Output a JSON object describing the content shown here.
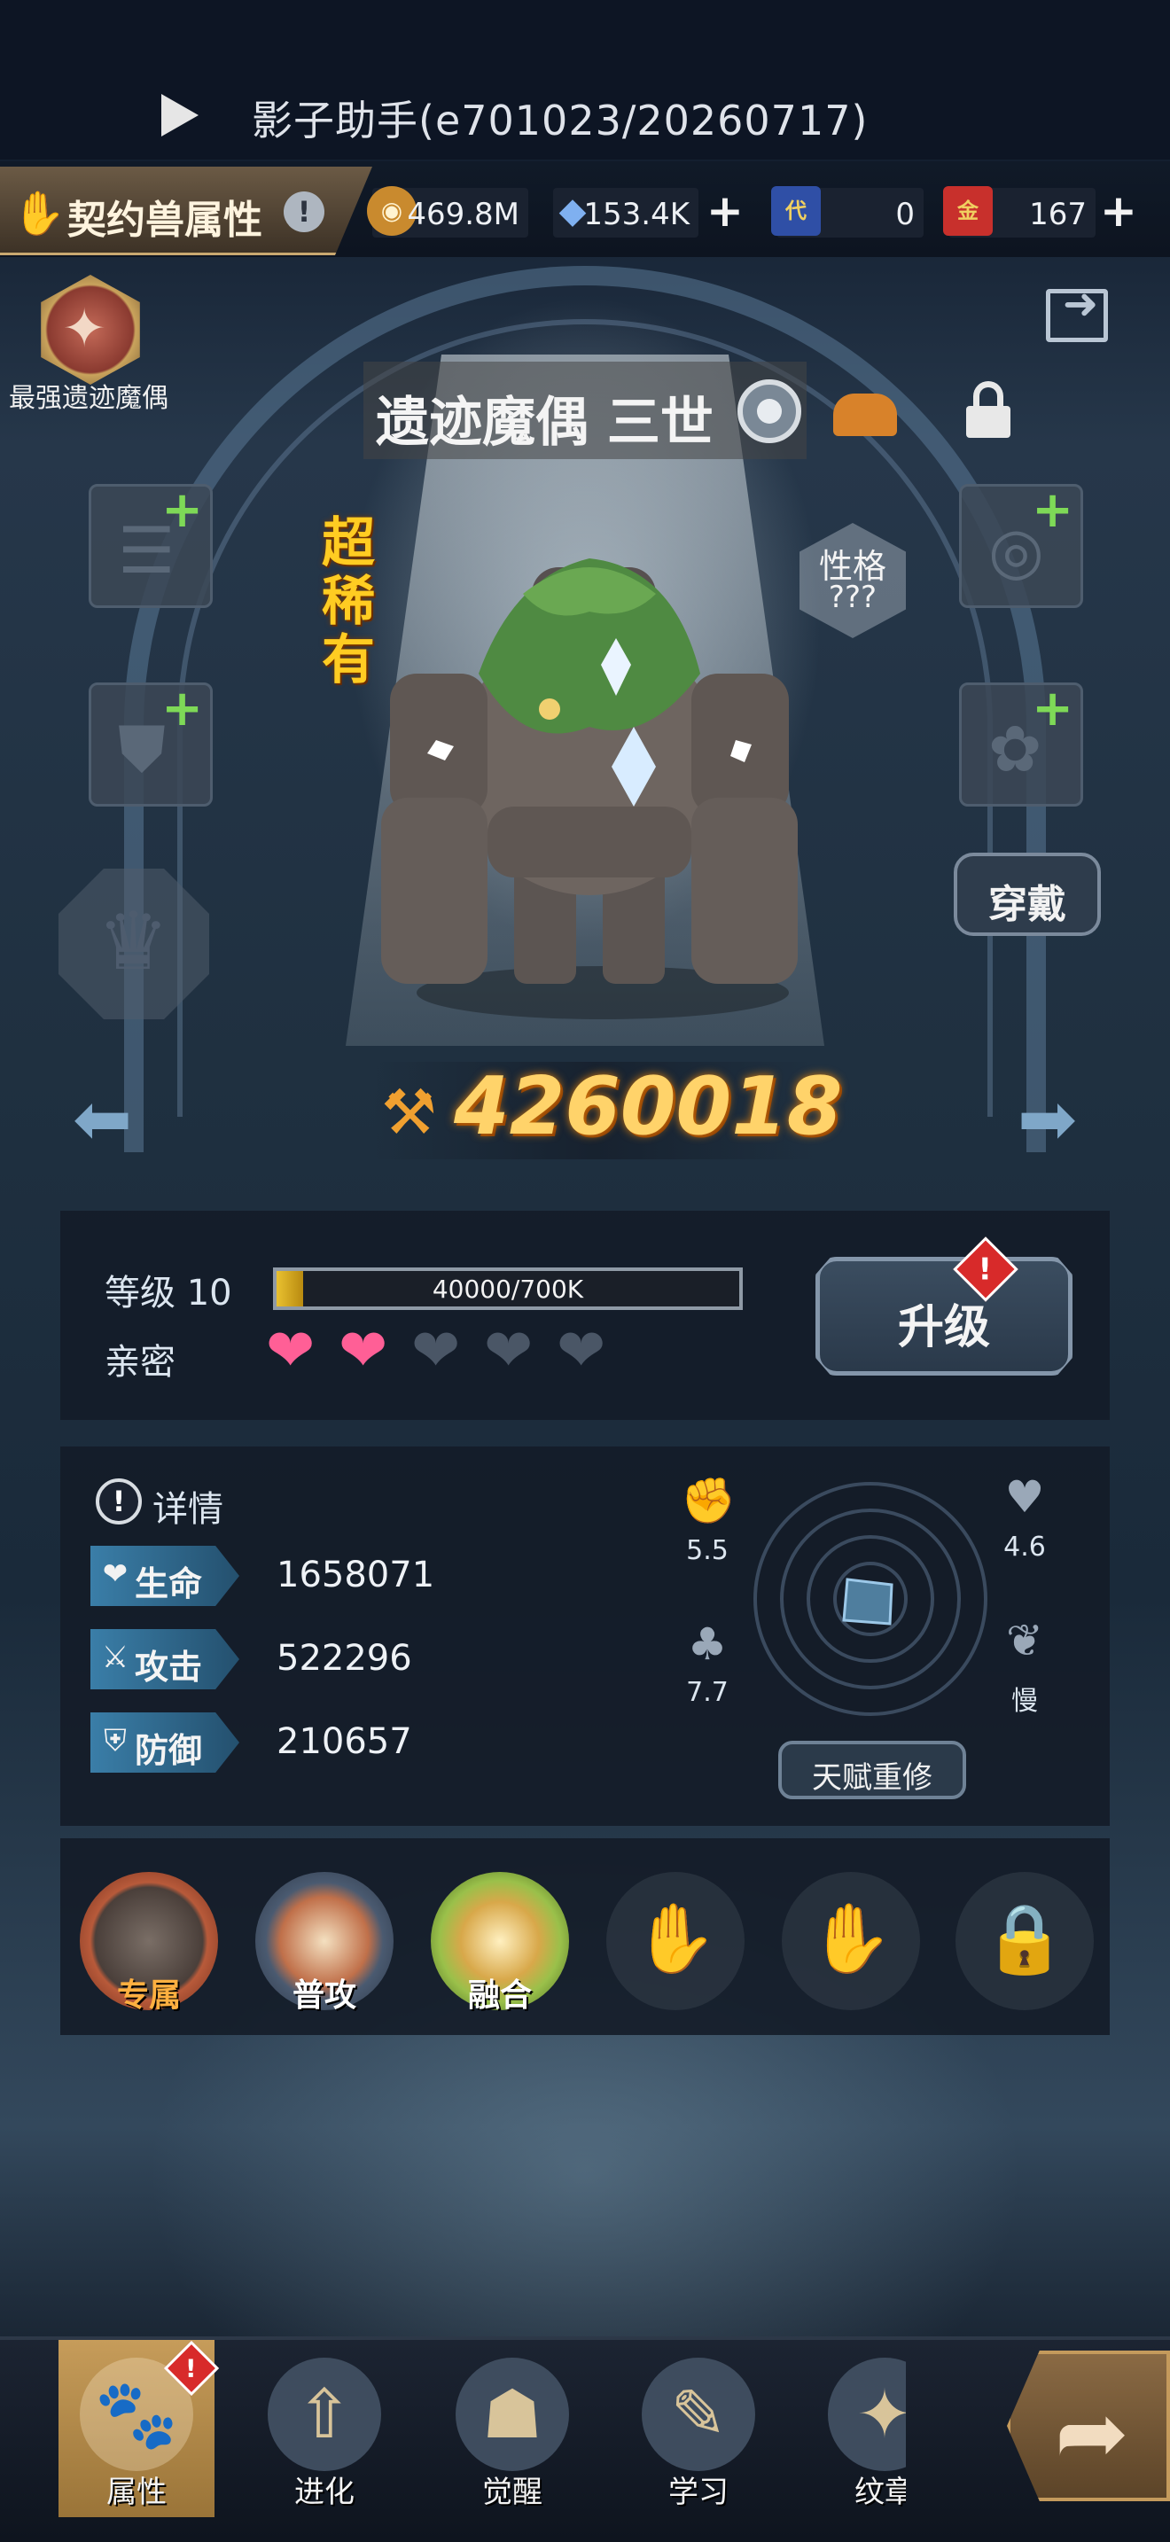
{
  "window": {
    "title": "影子助手(e701023/20260717)"
  },
  "header": {
    "page_title": "契约兽属性",
    "info_badge": "!",
    "currencies": [
      {
        "name": "gold-coin",
        "value": "469.8M",
        "color": "#c98a2e"
      },
      {
        "name": "crystal",
        "value": "153.4K",
        "color": "#5b8fd8"
      },
      {
        "name": "substitute-ticket",
        "icon_text": "代",
        "value": "0",
        "color": "#2f4fa6"
      },
      {
        "name": "gold-ticket",
        "icon_text": "金",
        "value": "167",
        "color": "#c8302c"
      }
    ]
  },
  "champion": {
    "label": "最强遗迹魔偶"
  },
  "monster": {
    "name": "遗迹魔偶 三世",
    "rarity": "超稀有",
    "personality_label": "性格",
    "personality_value": "???",
    "combat_power": "4260018"
  },
  "equip": {
    "button_label": "穿戴"
  },
  "level": {
    "label": "等级 10",
    "exp_text": "40000/700K",
    "exp_fraction": 0.057,
    "intimacy_label": "亲密",
    "intimacy_hearts": 2,
    "intimacy_max": 5,
    "upgrade_label": "升级",
    "alert": "!"
  },
  "stats": {
    "details_label": "详情",
    "rows": [
      {
        "icon": "heart-icon",
        "glyph": "❤",
        "name": "生命",
        "value": "1658071"
      },
      {
        "icon": "sword-icon",
        "glyph": "⚔",
        "name": "攻击",
        "value": "522296"
      },
      {
        "icon": "shield-icon",
        "glyph": "⛨",
        "name": "防御",
        "value": "210657"
      }
    ],
    "talents": [
      {
        "icon": "fist-icon",
        "glyph": "✊",
        "value": "5.5"
      },
      {
        "icon": "heart-outline-icon",
        "glyph": "♥",
        "value": "4.6"
      },
      {
        "icon": "clover-icon",
        "glyph": "♣",
        "value": "7.7"
      },
      {
        "icon": "wing-icon",
        "glyph": "❦",
        "value": "慢"
      }
    ],
    "reset_label": "天赋重修"
  },
  "skills": [
    {
      "label": "专属",
      "color": "#b85a3a"
    },
    {
      "label": "普攻",
      "color": "#6e8aa8"
    },
    {
      "label": "融合",
      "color": "#9ac04a"
    }
  ],
  "nav": {
    "items": [
      {
        "label": "属性",
        "glyph": "🐾",
        "active": true,
        "badge": "!"
      },
      {
        "label": "进化",
        "glyph": "⇧"
      },
      {
        "label": "觉醒",
        "glyph": "☗"
      },
      {
        "label": "学习",
        "glyph": "✎"
      },
      {
        "label": "纹章",
        "glyph": "✦"
      }
    ]
  }
}
